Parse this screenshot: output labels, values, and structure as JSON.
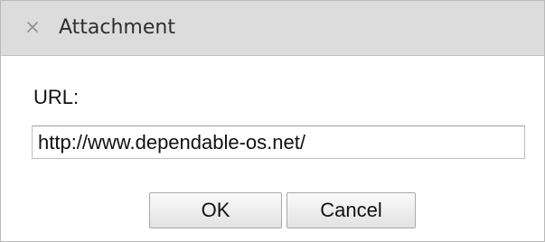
{
  "dialog": {
    "title": "Attachment",
    "close_icon": "close-icon"
  },
  "form": {
    "url_label": "URL:",
    "url_value": "http://www.dependable-os.net/"
  },
  "buttons": {
    "ok_label": "OK",
    "cancel_label": "Cancel"
  }
}
